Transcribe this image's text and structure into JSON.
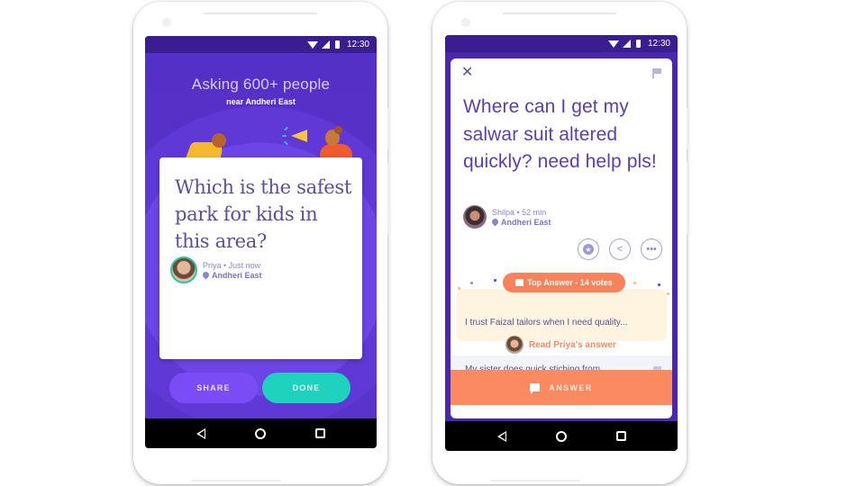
{
  "left_phone": {
    "status_bar": {
      "time": "12:30",
      "icons": [
        "wifi-icon",
        "signal-icon",
        "battery-icon"
      ]
    },
    "header": {
      "title": "Asking 600+ people",
      "subtitle": "near Andheri East"
    },
    "question_card": {
      "question": "Which is the safest park for kids in this area?",
      "author": "Priya",
      "time": "Just now",
      "author_meta": "Priya • Just now",
      "location": "Andheri East"
    },
    "buttons": {
      "share": "SHARE",
      "done": "DONE"
    },
    "colors": {
      "share": "#7a4cf5",
      "done": "#1ed2bd",
      "background": "#5a31c9"
    }
  },
  "right_phone": {
    "status_bar": {
      "time": "12:30",
      "icons": [
        "wifi-icon",
        "signal-icon",
        "battery-icon"
      ]
    },
    "question": "Where can I get my salwar suit altered quickly? need help pls!",
    "author_meta": "Shilpa • 52 min",
    "location": "Andheri East",
    "actions": [
      "star-icon",
      "share-icon",
      "more-icon"
    ],
    "top_answer": {
      "badge": "Top Answer - 14 votes",
      "excerpt": "I trust Faizal tailors when I need quality...",
      "read_link": "Read Priya's answer"
    },
    "next_answer": {
      "excerpt": "My sister does quick stiching from"
    },
    "answer_button": "ANSWER",
    "colors": {
      "accent": "#fc8a60",
      "primary": "#4b27ad"
    }
  },
  "nav_bar": {
    "buttons": [
      "back-icon",
      "home-icon",
      "recents-icon"
    ]
  }
}
